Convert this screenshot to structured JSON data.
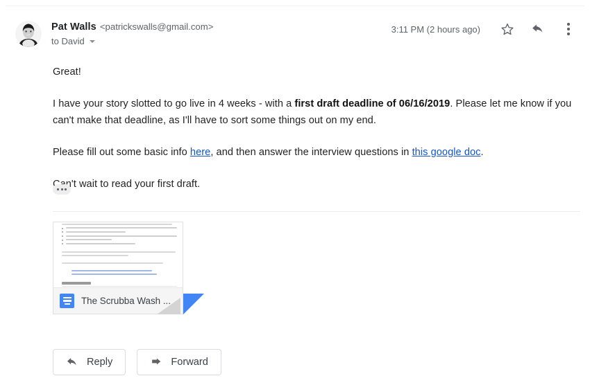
{
  "message": {
    "sender_name": "Pat Walls",
    "sender_email": "<patrickswalls@gmail.com>",
    "recipient": "to David",
    "timestamp": "3:11 PM (2 hours ago)",
    "avatar_alt": "Pat Walls profile photo"
  },
  "header_actions": {
    "star_label": "Star",
    "reply_label": "Reply",
    "more_label": "More"
  },
  "body": {
    "greeting": "Great!",
    "para2_part1": "I have your story slotted to go live in 4 weeks - with a ",
    "para2_bold": "first draft deadline of 06/16/2019",
    "para2_part2": ". Please let me know if you can't make that deadline, as I'll have to sort some things out on my end.",
    "para3_part1": "Please fill out some basic info ",
    "para3_link1": "here",
    "para3_part2": ", and then answer the interview questions in ",
    "para3_link2": "this google doc",
    "para3_part3": ".",
    "para4": "Can't wait to read your first draft.",
    "trimmed_content_label": "Show trimmed content"
  },
  "attachment": {
    "name": "The Scrubba Wash ...",
    "type": "google-docs",
    "preview_heading": "Interview:"
  },
  "footer": {
    "reply_label": "Reply",
    "forward_label": "Forward"
  },
  "colors": {
    "link": "#1155cc",
    "google_blue": "#4285f4",
    "text": "#222222",
    "muted": "#5f6368"
  }
}
